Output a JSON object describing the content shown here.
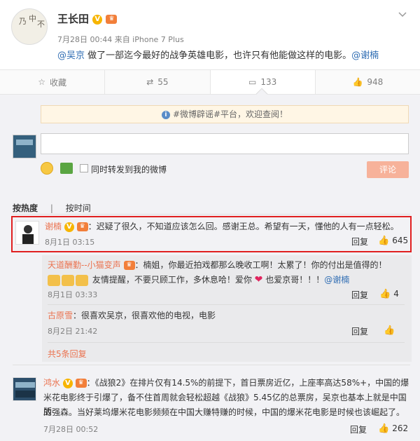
{
  "post": {
    "author": "王长田",
    "avatar_text": [
      "乃",
      "中",
      "不"
    ],
    "meta": "7月28日 00:44 来自 iPhone 7 Plus",
    "mention1": "@吴京",
    "text": " 做了一部迄今最好的战争英雄电影，也许只有他能做这样的电影。",
    "mention2": "@谢楠"
  },
  "actions": {
    "favorite": "收藏",
    "repost": "55",
    "comment": "133",
    "like": "948"
  },
  "comment_panel": {
    "notice": "#微博辟谣#平台，欢迎查阅！",
    "repost_checkbox_label": "同时转发到我的微博",
    "submit_label": "评论",
    "tab_hot": "按热度",
    "tab_time": "按时间"
  },
  "comments": [
    {
      "name": "谢楠",
      "text": "：迟疑了很久，不知道应该怎么回。感谢王总。希望有一天，懂他的人有一点轻松。",
      "time": "8月1日 03:15",
      "reply": "回复",
      "likes": "645"
    }
  ],
  "sub_comments": [
    {
      "name": "天道酬勤--小猫变声",
      "text1": "：楠姐，你最近拍戏都那么晚收工啊！太累了！你的付出是值得的！",
      "text2": "友情提醒，不要只顾工作，多休息哈！爱你",
      "text3": "也爱京哥！！！",
      "mention": "@谢楠",
      "time": "8月1日 03:33",
      "reply": "回复",
      "likes": "4"
    },
    {
      "name": "古原雪",
      "text": "：很喜欢吴京，很喜欢他的电视，电影",
      "time": "8月2日 21:42",
      "reply": "回复"
    }
  ],
  "more_replies": "共5条回复",
  "third_comment": {
    "name": "鸿水",
    "line1": "：《战狼2》在排片仅有14.5%的前提下，首日票房近亿，上座率高达58%+，中国的爆",
    "line2": "米花电影终于引爆了，备不住首周就会轻松超越《战狼》5.45亿的总票房，吴京也基本上就是中国版",
    "line3": "的强森。当好莱坞爆米花电影频频在中国大赚特赚的时候，中国的爆米花电影是时候也该崛起了。",
    "time": "7月28日 00:52",
    "reply": "回复",
    "likes": "262"
  },
  "colors": {
    "link": "#eb7350",
    "mention_blue": "#2f6db3",
    "highlight_border": "#e02020",
    "panel_bg": "#f2f2f5"
  }
}
